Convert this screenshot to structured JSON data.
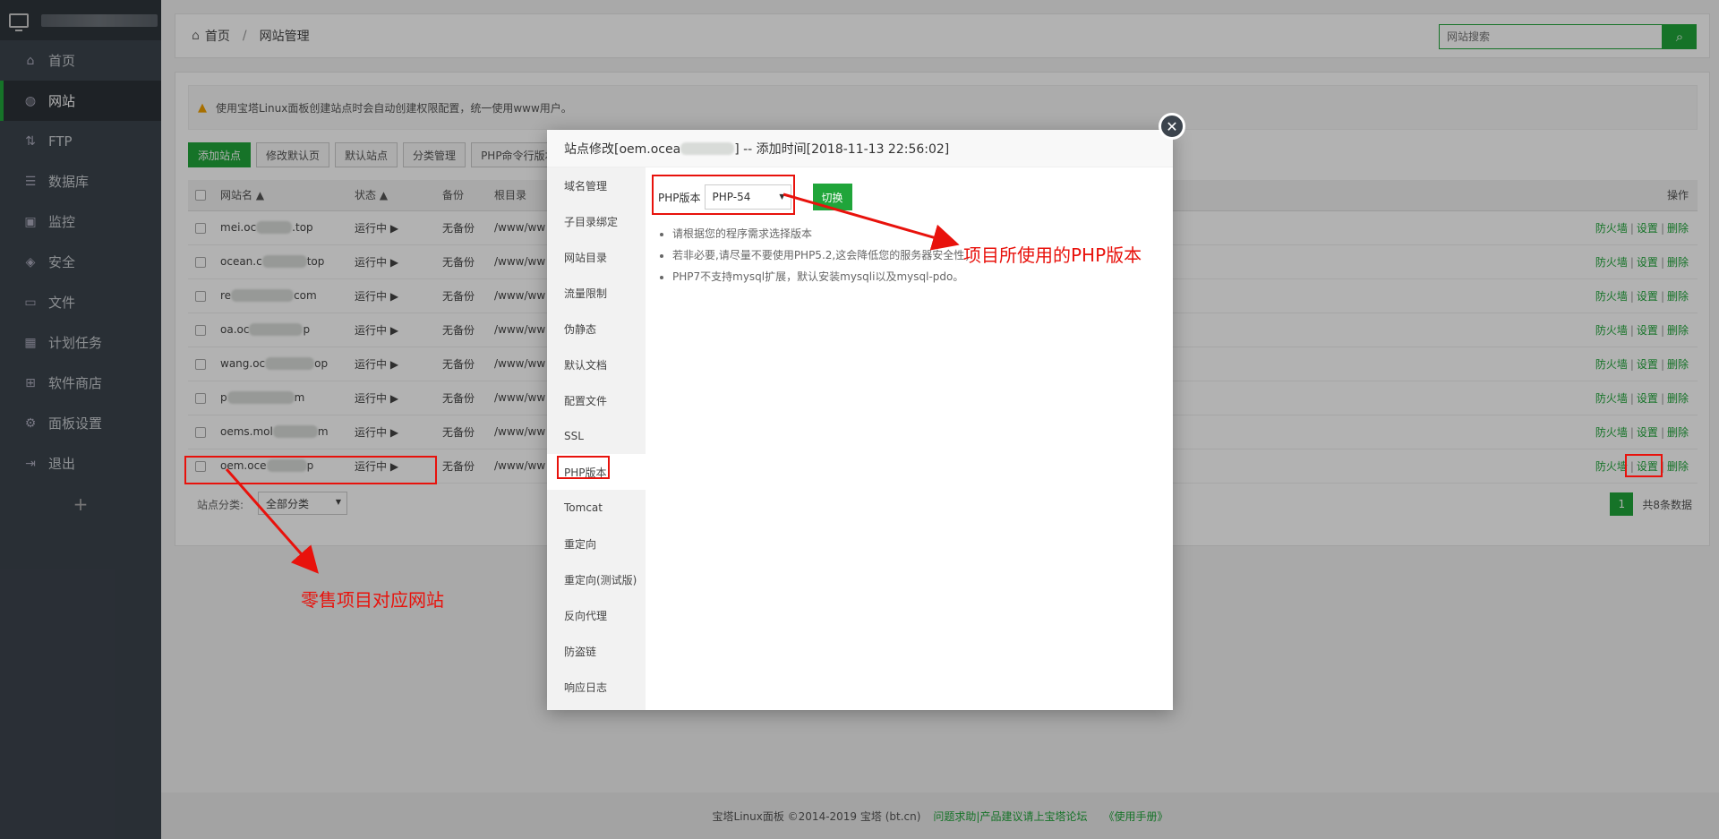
{
  "sidebar": {
    "items": [
      {
        "label": "首页",
        "icon": "home-icon"
      },
      {
        "label": "网站",
        "icon": "globe-icon"
      },
      {
        "label": "FTP",
        "icon": "ftp-icon"
      },
      {
        "label": "数据库",
        "icon": "database-icon"
      },
      {
        "label": "监控",
        "icon": "monitor-icon"
      },
      {
        "label": "安全",
        "icon": "shield-icon"
      },
      {
        "label": "文件",
        "icon": "folder-icon"
      },
      {
        "label": "计划任务",
        "icon": "calendar-icon"
      },
      {
        "label": "软件商店",
        "icon": "grid-icon"
      },
      {
        "label": "面板设置",
        "icon": "gear-icon"
      },
      {
        "label": "退出",
        "icon": "logout-icon"
      }
    ],
    "add_label": "+"
  },
  "header": {
    "crumb_home": "首页",
    "crumb_sep": "/",
    "crumb_current": "网站管理",
    "search_placeholder": "网站搜索"
  },
  "notice": "使用宝塔Linux面板创建站点时会自动创建权限配置，统一使用www用户。",
  "toolbar": {
    "add_site": "添加站点",
    "edit_default_page": "修改默认页",
    "default_site": "默认站点",
    "category_manage": "分类管理",
    "php_cli": "PHP命令行版本"
  },
  "table": {
    "headers": {
      "name": "网站名 ▲",
      "status": "状态 ▲",
      "backup": "备份",
      "root": "根目录",
      "ops": "操作"
    },
    "rows": [
      {
        "prefix": "mei.oc",
        "suffix": ".top",
        "status": "运行中 ▶",
        "backup": "无备份",
        "root": "/www/ww"
      },
      {
        "prefix": "ocean.c",
        "suffix": "top",
        "status": "运行中 ▶",
        "backup": "无备份",
        "root": "/www/ww"
      },
      {
        "prefix": "re",
        "suffix": "com",
        "status": "运行中 ▶",
        "backup": "无备份",
        "root": "/www/ww"
      },
      {
        "prefix": "oa.oc",
        "suffix": "p",
        "status": "运行中 ▶",
        "backup": "无备份",
        "root": "/www/ww"
      },
      {
        "prefix": "wang.oc",
        "suffix": "op",
        "status": "运行中 ▶",
        "backup": "无备份",
        "root": "/www/ww"
      },
      {
        "prefix": "p",
        "suffix": "m",
        "status": "运行中 ▶",
        "backup": "无备份",
        "root": "/www/ww"
      },
      {
        "prefix": "oems.mol",
        "suffix": "m",
        "status": "运行中 ▶",
        "backup": "无备份",
        "root": "/www/ww"
      },
      {
        "prefix": "oem.oce",
        "suffix": "p",
        "status": "运行中 ▶",
        "backup": "无备份",
        "root": "/www/ww"
      }
    ],
    "op_firewall": "防火墙",
    "op_settings": "设置",
    "op_delete": "删除",
    "op_sep": "|"
  },
  "footbar": {
    "category_label": "站点分类:",
    "category_value": "全部分类",
    "page": "1",
    "total": "共8条数据"
  },
  "footer": {
    "copyright": "宝塔Linux面板 ©2014-2019 宝塔 (bt.cn)",
    "help": "问题求助|产品建议请上宝塔论坛",
    "manual": "《使用手册》"
  },
  "modal": {
    "title_prefix": "站点修改[oem.ocea",
    "title_suffix": "] -- 添加时间[2018-11-13 22:56:02]",
    "nav": [
      "域名管理",
      "子目录绑定",
      "网站目录",
      "流量限制",
      "伪静态",
      "默认文档",
      "配置文件",
      "SSL",
      "PHP版本",
      "Tomcat",
      "重定向",
      "重定向(测试版)",
      "反向代理",
      "防盗链",
      "响应日志"
    ],
    "php_label": "PHP版本",
    "php_value": "PHP-54",
    "switch_label": "切换",
    "tips": [
      "请根据您的程序需求选择版本",
      "若非必要,请尽量不要使用PHP5.2,这会降低您的服务器安全性；",
      "PHP7不支持mysql扩展，默认安装mysqli以及mysql-pdo。"
    ]
  },
  "annotations": {
    "php_note": "项目所使用的PHP版本",
    "site_note": "零售项目对应网站"
  },
  "colors": {
    "accent": "#20a53a",
    "annotation": "#e8120c",
    "sidebar": "#3c444d"
  }
}
